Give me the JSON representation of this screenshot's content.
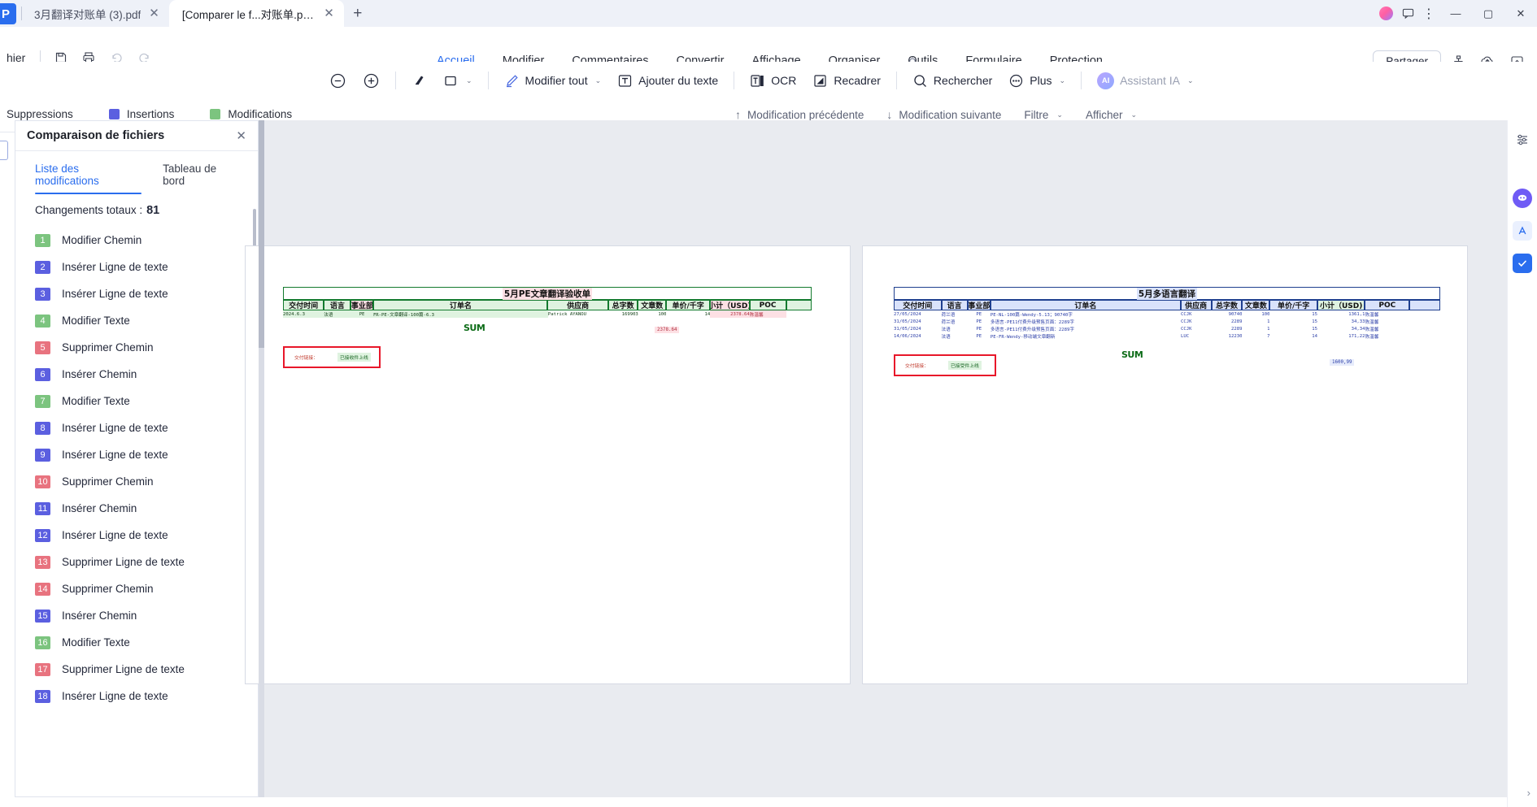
{
  "window": {
    "tabs": [
      {
        "label": "3月翻译对账单 (3).pdf",
        "close": "✕",
        "active": false
      },
      {
        "label": "[Comparer le f...对账单.pdf *",
        "close": "✕",
        "active": true
      }
    ],
    "new_tab": "+",
    "controls": {
      "minimize": "—",
      "maximize": "▢",
      "close": "✕",
      "more": "⋮"
    },
    "icons": {
      "avatar": "avatar-badge",
      "comment": "comment-icon",
      "more": "more-vertical-icon"
    }
  },
  "quickbar": {
    "file_label": "hier",
    "save": "save-icon",
    "print": "print-icon",
    "undo": "undo-icon",
    "redo": "redo-icon"
  },
  "menu": {
    "items": [
      {
        "label": "Accueil",
        "active": true
      },
      {
        "label": "Modifier",
        "active": false
      },
      {
        "label": "Commentaires",
        "active": false
      },
      {
        "label": "Convertir",
        "active": false
      },
      {
        "label": "Affichage",
        "active": false
      },
      {
        "label": "Organiser",
        "active": false
      },
      {
        "label": "Outils",
        "active": false
      },
      {
        "label": "Formulaire",
        "active": false
      },
      {
        "label": "Protection",
        "active": false
      }
    ],
    "bulb_icon": "lightbulb-icon"
  },
  "ribbon_right": {
    "share_label": "Partager",
    "icons": [
      "org-chart-icon",
      "cloud-upload-icon",
      "collapse-ribbon-icon"
    ]
  },
  "toolbar": {
    "zoom_out": "zoom-out-icon",
    "zoom_in": "zoom-in-icon",
    "highlight": "highlighter-icon",
    "shape": "rectangle-icon",
    "edit_all": "Modifier tout",
    "add_text": "Ajouter du texte",
    "ocr": "OCR",
    "crop": "Recadrer",
    "search": "Rechercher",
    "more": "Plus",
    "ai_assistant": "Assistant IA",
    "ai_badge": "AI",
    "caret": "⌄"
  },
  "compare_bar": {
    "legend": [
      {
        "label": "Suppressions",
        "color": "#e8737f",
        "swatch_visible": false
      },
      {
        "label": "Insertions",
        "color": "#5b5fe0",
        "swatch_visible": true
      },
      {
        "label": "Modifications",
        "color": "#7cc47f",
        "swatch_visible": true
      }
    ],
    "prev_label": "Modification précédente",
    "next_label": "Modification suivante",
    "prev_icon": "arrow-up-icon",
    "next_icon": "arrow-down-icon",
    "filter_label": "Filtre",
    "display_label": "Afficher",
    "caret": "⌄"
  },
  "panel": {
    "title": "Comparaison de fichiers",
    "close": "✕",
    "tabs": [
      {
        "label": "Liste des modifications",
        "active": true
      },
      {
        "label": "Tableau de bord",
        "active": false
      }
    ],
    "totals_label": "Changements totaux :",
    "totals_value": "81",
    "changes": [
      {
        "num": "1",
        "label": "Modifier Chemin",
        "color": "#7cc47f"
      },
      {
        "num": "2",
        "label": "Insérer Ligne de texte",
        "color": "#5b5fe0"
      },
      {
        "num": "3",
        "label": "Insérer Ligne de texte",
        "color": "#5b5fe0"
      },
      {
        "num": "4",
        "label": "Modifier Texte",
        "color": "#7cc47f"
      },
      {
        "num": "5",
        "label": "Supprimer Chemin",
        "color": "#e8737f"
      },
      {
        "num": "6",
        "label": "Insérer Chemin",
        "color": "#5b5fe0"
      },
      {
        "num": "7",
        "label": "Modifier Texte",
        "color": "#7cc47f"
      },
      {
        "num": "8",
        "label": "Insérer Ligne de texte",
        "color": "#5b5fe0"
      },
      {
        "num": "9",
        "label": "Insérer Ligne de texte",
        "color": "#5b5fe0"
      },
      {
        "num": "10",
        "label": "Supprimer Chemin",
        "color": "#e8737f"
      },
      {
        "num": "11",
        "label": "Insérer Chemin",
        "color": "#5b5fe0"
      },
      {
        "num": "12",
        "label": "Insérer Ligne de texte",
        "color": "#5b5fe0"
      },
      {
        "num": "13",
        "label": "Supprimer Ligne de texte",
        "color": "#e8737f"
      },
      {
        "num": "14",
        "label": "Supprimer Chemin",
        "color": "#e8737f"
      },
      {
        "num": "15",
        "label": "Insérer Chemin",
        "color": "#5b5fe0"
      },
      {
        "num": "16",
        "label": "Modifier Texte",
        "color": "#7cc47f"
      },
      {
        "num": "17",
        "label": "Supprimer Ligne de texte",
        "color": "#e8737f"
      },
      {
        "num": "18",
        "label": "Insérer Ligne de texte",
        "color": "#5b5fe0"
      }
    ]
  },
  "doc_left": {
    "title": "5月PE文章翻译验收单",
    "headers": [
      "交付时间",
      "语言",
      "事业部",
      "订单名",
      "供应商",
      "总字数",
      "文章数",
      "单价/千字",
      "小计（USD)",
      "POC",
      ""
    ],
    "rows": [
      [
        "2024.6.3",
        "法语",
        "PE",
        "FR-PE-文章翻译-100篇-6.3",
        "Patrick AYANOU",
        "169903",
        "100",
        "14",
        "2378.64",
        "陈温馨",
        ""
      ]
    ],
    "sum_label": "SUM",
    "sum_value": "2378.64",
    "note_label": "交付链接：",
    "note_value": "已接收件上线"
  },
  "doc_right": {
    "title": "5月多语言翻译",
    "headers": [
      "交付时间",
      "语言",
      "事业部",
      "订单名",
      "供应商",
      "总字数",
      "文章数",
      "单价/千字",
      "小计（USD)",
      "POC",
      ""
    ],
    "rows": [
      [
        "27/05/2024",
        "荷兰语",
        "PE",
        "PE-NL-100篇-Wendy-5.13；90740字",
        "CCJK",
        "90740",
        "100",
        "15",
        "1361,1",
        "陈温馨"
      ],
      [
        "31/05/2024",
        "荷兰语",
        "PE",
        "多语言-PE11付费升级预售页面：2289字",
        "CCJK",
        "2289",
        "1",
        "15",
        "34,33",
        "陈温馨"
      ],
      [
        "31/05/2024",
        "法语",
        "PE",
        "多语言-PE11付费升级预售页面：2289字",
        "CCJK",
        "2289",
        "1",
        "15",
        "34,34",
        "陈温馨"
      ],
      [
        "14/06/2024",
        "法语",
        "PE",
        "PE-FR-Wendy-移动端文章翻新",
        "LUC",
        "12230",
        "7",
        "14",
        "171,22",
        "陈温馨"
      ]
    ],
    "sum_label": "SUM",
    "sum_value": "1600,99",
    "note_label": "交付链接：",
    "note_value": "已接受件上线"
  },
  "rail": {
    "icons": [
      "sliders-icon",
      "comment-bubble-icon",
      "text-format-icon",
      "checkbox-icon"
    ],
    "expand": "›"
  }
}
